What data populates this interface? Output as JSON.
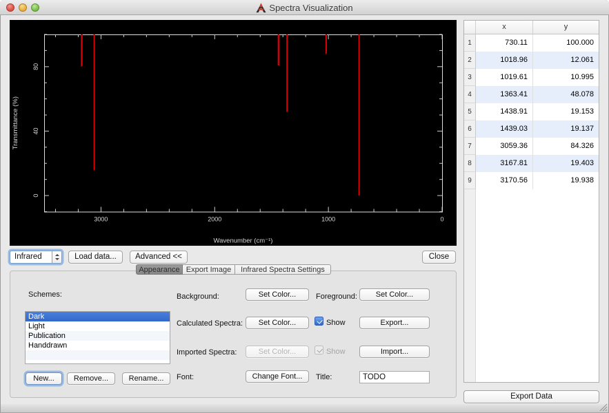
{
  "window": {
    "title": "Spectra Visualization"
  },
  "toolbar": {
    "spectra_type": "Infrared",
    "load_data_label": "Load data...",
    "advanced_label": "Advanced <<",
    "close_label": "Close"
  },
  "tabs": [
    {
      "label": "Appearance",
      "selected": true
    },
    {
      "label": "Export Image",
      "selected": false
    },
    {
      "label": "Infrared Spectra Settings",
      "selected": false
    }
  ],
  "appearance": {
    "schemes_label": "Schemes:",
    "schemes": [
      "Dark",
      "Light",
      "Publication",
      "Handdrawn"
    ],
    "selected_scheme": "Dark",
    "new_label": "New...",
    "remove_label": "Remove...",
    "rename_label": "Rename...",
    "background_label": "Background:",
    "foreground_label": "Foreground:",
    "calculated_label": "Calculated Spectra:",
    "imported_label": "Imported Spectra:",
    "font_label": "Font:",
    "title_label": "Title:",
    "set_color_label": "Set Color...",
    "change_font_label": "Change Font...",
    "export_label": "Export...",
    "import_label": "Import...",
    "show_label": "Show",
    "calculated_show_checked": true,
    "imported_show_checked": true,
    "imported_enabled": false,
    "title_value": "TODO"
  },
  "table": {
    "columns": [
      "x",
      "y"
    ],
    "rows": [
      [
        "730.11",
        "100.000"
      ],
      [
        "1018.96",
        "12.061"
      ],
      [
        "1019.61",
        "10.995"
      ],
      [
        "1363.41",
        "48.078"
      ],
      [
        "1438.91",
        "19.153"
      ],
      [
        "1439.03",
        "19.137"
      ],
      [
        "3059.36",
        "84.326"
      ],
      [
        "3167.81",
        "19.403"
      ],
      [
        "3170.56",
        "19.938"
      ]
    ],
    "export_label": "Export Data"
  },
  "chart_data": {
    "type": "stem",
    "title": "",
    "xlabel": "Wavenumber (cm⁻¹)",
    "ylabel": "Transmittance (%)",
    "xlim": [
      3500,
      0
    ],
    "ylim": [
      -10,
      100
    ],
    "x_major_ticks": [
      3000,
      2000,
      1000,
      0
    ],
    "x_minor_step": 200,
    "y_major_ticks": [
      0,
      40,
      80
    ],
    "y_minor_step": 10,
    "baseline": 100,
    "peaks": [
      {
        "x": 730.11,
        "y": 100.0
      },
      {
        "x": 1018.96,
        "y": 12.061
      },
      {
        "x": 1019.61,
        "y": 10.995
      },
      {
        "x": 1363.41,
        "y": 48.078
      },
      {
        "x": 1438.91,
        "y": 19.153
      },
      {
        "x": 1439.03,
        "y": 19.137
      },
      {
        "x": 3059.36,
        "y": 84.326
      },
      {
        "x": 3167.81,
        "y": 19.403
      },
      {
        "x": 3170.56,
        "y": 19.938
      }
    ],
    "colors": {
      "background": "#000000",
      "frame": "#dedede",
      "ticks": "#cfcfcf",
      "labels": "#d6d6d6",
      "peaks": "#d80000",
      "selection": "#3b74d4",
      "table_stripe": "#e6eefb"
    },
    "legend": false,
    "grid": false
  }
}
